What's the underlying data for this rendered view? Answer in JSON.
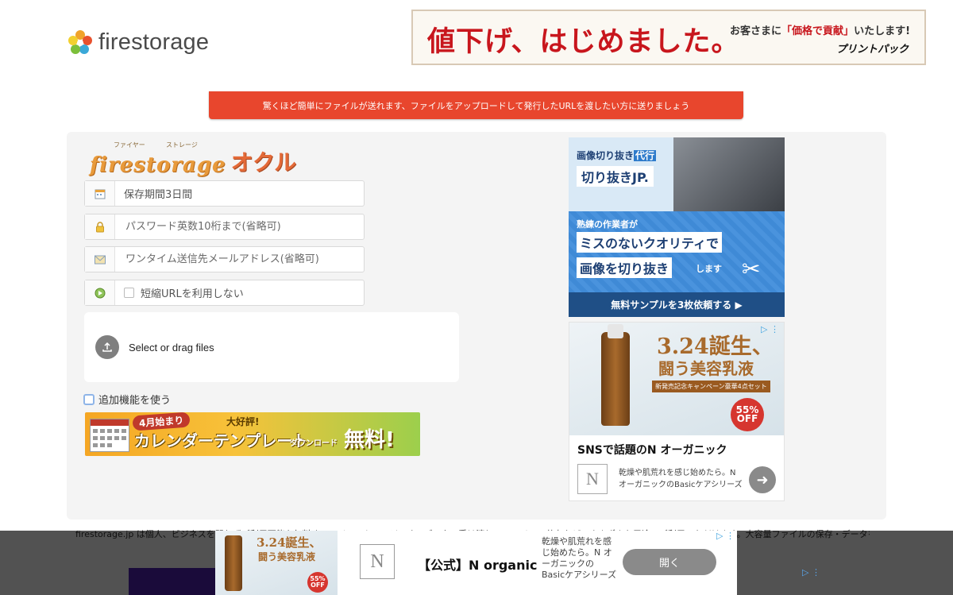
{
  "header": {
    "logo_text": "firestorage",
    "ad": {
      "headline": "値下げ、はじめました。",
      "sub_prefix": "お客さまに",
      "sub_highlight": "「価格で貢献」",
      "sub_suffix": "いたします!",
      "brand": "プリントパック"
    }
  },
  "notice": "驚くほど簡単にファイルが送れます、ファイルをアップロードして発行したURLを渡したい方に送りましょう",
  "okuru": {
    "logo_main": "firestorage",
    "logo_kana": "オクル",
    "ruby_1": "ファイヤー",
    "ruby_2": "ストレージ"
  },
  "form": {
    "retention_value": "保存期間3日間",
    "password_placeholder": "パスワード英数10桁まで(省略可)",
    "email_placeholder": "ワンタイム送信先メールアドレス(省略可)",
    "short_url_label": "短縮URLを利用しない"
  },
  "dropzone": {
    "label": "Select or drag files"
  },
  "extra_features_label": "追加機能を使う",
  "calendar_banner": {
    "april": "4月始まり",
    "popular": "大好評!",
    "main": "カレンダーテンプレート",
    "download": "ダウンロード",
    "free": "無料!"
  },
  "ad_kirinuki": {
    "line1_prefix": "画像切り抜き",
    "line1_highlight": "代行",
    "brand": "切り抜きJP.",
    "m1": "熟練の作業者が",
    "m2": "ミスのないクオリティで",
    "m3": "画像を切り抜き",
    "m3_suffix": "します",
    "cta": "無料サンプルを3枚依頼する ▶"
  },
  "ad_norganic": {
    "headline": "3.24誕生、",
    "headline2": "闘う美容乳液",
    "campaign": "新発売記念キャンペーン豪華4点セット",
    "off": "55% OFF",
    "title": "SNSで話題のN オーガニック",
    "desc": "乾燥や肌荒れを感じ始めたら。N オーガニックのBasicケアシリーズ",
    "logo": "N"
  },
  "footer_text": "firestorage.jp は個人、ビジネスを問わずご利用可能な無料オンラインストレージです。データの受け渡し、ファイルの共有など、さまざまな用途でご利用いただけます。大容量ファイルの保存・データを送るのに便",
  "bottom_ad": {
    "headline": "3.24誕生、",
    "headline2": "闘う美容乳液",
    "off": "55% OFF",
    "logo": "N",
    "title": "【公式】N organic",
    "desc": "乾燥や肌荒れを感じ始めたら。N オーガニックのBasicケアシリーズ",
    "button": "開く"
  },
  "colors": {
    "notice_bg": "#e8462d",
    "kirinuki_blue": "#2e7bcb",
    "norganic_brown": "#a86a2c"
  }
}
